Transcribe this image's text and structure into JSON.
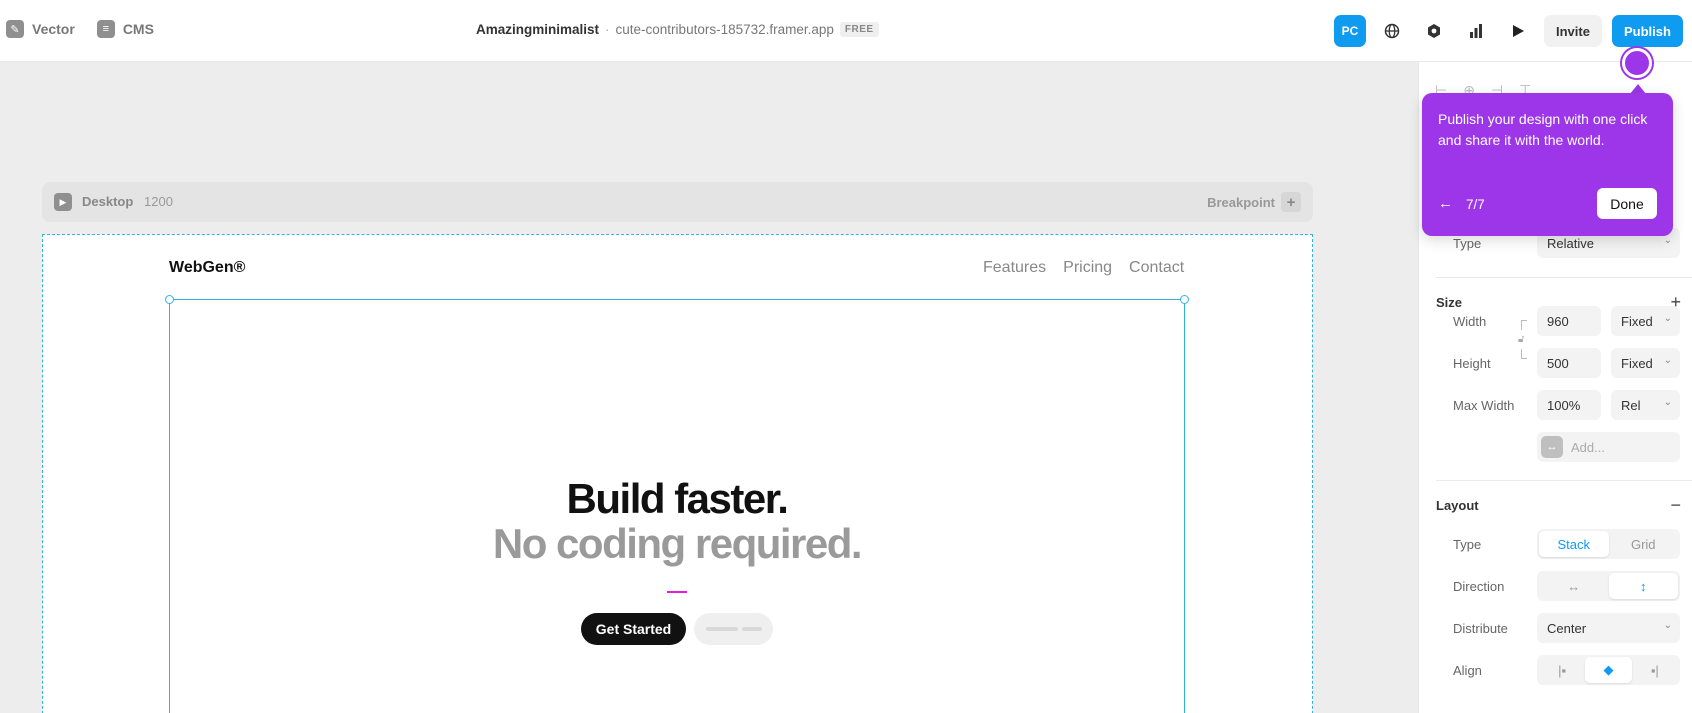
{
  "toolbar": {
    "vector_label": "Vector",
    "cms_label": "CMS",
    "project_name": "Amazingminimalist",
    "separator": "·",
    "project_url": "cute-contributors-185732.framer.app",
    "plan_badge": "FREE",
    "pc_label": "PC",
    "invite_label": "Invite",
    "publish_label": "Publish"
  },
  "canvas": {
    "breakpoint_name": "Desktop",
    "breakpoint_width": "1200",
    "breakpoint_add_label": "Breakpoint",
    "site_logo": "WebGen®",
    "nav_links": [
      "Features",
      "Pricing",
      "Contact"
    ],
    "hero_line_1": "Build faster.",
    "hero_line_2": "No coding required.",
    "cta_primary": "Get Started"
  },
  "panel": {
    "position_type_label": "Type",
    "position_type_value": "Relative",
    "size_heading": "Size",
    "width_label": "Width",
    "width_value": "960",
    "width_mode": "Fixed",
    "height_label": "Height",
    "height_value": "500",
    "height_mode": "Fixed",
    "max_width_label": "Max Width",
    "max_width_value": "100%",
    "max_width_mode": "Rel",
    "add_placeholder": "Add...",
    "layout_heading": "Layout",
    "layout_type_label": "Type",
    "layout_type_options": [
      "Stack",
      "Grid"
    ],
    "direction_label": "Direction",
    "distribute_label": "Distribute",
    "distribute_value": "Center",
    "align_label": "Align"
  },
  "tooltip": {
    "text": "Publish your design with one click and share it with the world.",
    "step": "7/7",
    "done_label": "Done"
  },
  "colors": {
    "accent": "#0f9bef",
    "tooltip": "#9c36e8",
    "selection": "#34b1e5"
  }
}
